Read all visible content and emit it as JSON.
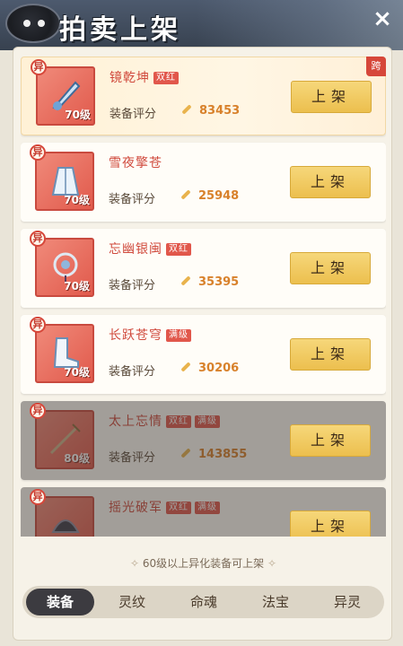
{
  "header": {
    "title": "拍卖上架",
    "close_glyph": "×"
  },
  "items": [
    {
      "name": "镜乾坤",
      "badge": "双红",
      "level": "70级",
      "score_label": "装备评分",
      "score": "83453",
      "button": "上架",
      "rarity": "异",
      "cross_tag": "跨",
      "featured": true,
      "locked": false
    },
    {
      "name": "雪夜擎苍",
      "badge": "",
      "level": "70级",
      "score_label": "装备评分",
      "score": "25948",
      "button": "上架",
      "rarity": "异",
      "featured": false,
      "locked": false
    },
    {
      "name": "忘幽银闽",
      "badge": "双红",
      "level": "70级",
      "score_label": "装备评分",
      "score": "35395",
      "button": "上架",
      "rarity": "异",
      "featured": false,
      "locked": false
    },
    {
      "name": "长跃苍穹",
      "badge": "满级",
      "level": "70级",
      "score_label": "装备评分",
      "score": "30206",
      "button": "上架",
      "rarity": "异",
      "featured": false,
      "locked": false
    },
    {
      "name": "太上忘情",
      "badge": "双红",
      "badge2": "满级",
      "level": "80级",
      "score_label": "装备评分",
      "score": "143855",
      "button": "上架",
      "rarity": "异",
      "featured": false,
      "locked": true
    },
    {
      "name": "摇光破军",
      "badge": "双红",
      "badge2": "满级",
      "level": "",
      "score_label": "",
      "score": "",
      "button": "上架",
      "rarity": "异",
      "featured": false,
      "locked": true
    }
  ],
  "hint": "60级以上异化装备可上架",
  "tabs": [
    {
      "label": "装备",
      "active": true
    },
    {
      "label": "灵纹",
      "active": false
    },
    {
      "label": "命魂",
      "active": false
    },
    {
      "label": "法宝",
      "active": false
    },
    {
      "label": "异灵",
      "active": false
    }
  ],
  "colors": {
    "header_bg": "#3f4a5a",
    "panel_bg": "#f6f2e8",
    "accent_red": "#d04a3d",
    "score_orange": "#d8812b",
    "button_gold": "#ecbf4e",
    "active_tab": "#3c3b40"
  }
}
